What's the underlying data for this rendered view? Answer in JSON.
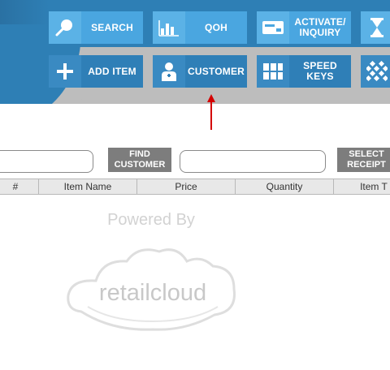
{
  "toolbar": {
    "row1": {
      "search_label": "SEARCH",
      "qoh_label": "QOH",
      "activate_label": "ACTIVATE/ INQUIRY"
    },
    "row2": {
      "add_item_label": "ADD ITEM",
      "customer_label": "CUSTOMER",
      "speed_keys_label": "SPEED KEYS"
    },
    "icons": [
      "search-icon",
      "bar-chart-icon",
      "card-icon",
      "hourglass-icon",
      "plus-icon",
      "person-icon",
      "keypad-icon",
      "grid-icon"
    ]
  },
  "lookup": {
    "find_customer_label": "FIND CUSTOMER",
    "select_receipt_label": "SELECT RECEIPT"
  },
  "table": {
    "columns": [
      "#",
      "Item Name",
      "Price",
      "Quantity",
      "Item T"
    ]
  },
  "watermark": {
    "powered_by": "Powered By",
    "brand": "retailcloud"
  },
  "colors": {
    "primary": "#2e7fb5",
    "button_light": "#4aa6e0",
    "button_dark": "#2f7fb7",
    "band_grey": "#bdbdbd",
    "annotation_red": "#d40000"
  }
}
